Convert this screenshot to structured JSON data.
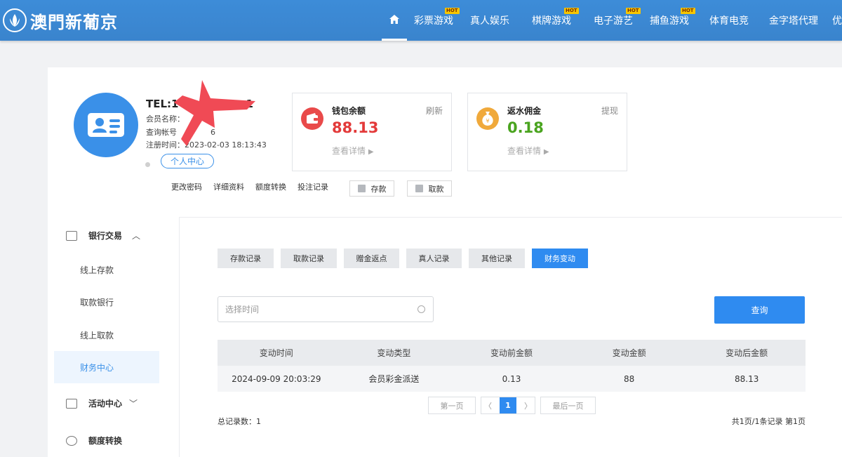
{
  "header": {
    "logo_text": "澳門新葡京",
    "hot_badge": "HOT",
    "nav": [
      {
        "label": "彩票游戏",
        "hot": true
      },
      {
        "label": "真人娱乐",
        "hot": false
      },
      {
        "label": "棋牌游戏",
        "hot": true
      },
      {
        "label": "电子游艺",
        "hot": true
      },
      {
        "label": "捕鱼游戏",
        "hot": true
      },
      {
        "label": "体育电竞",
        "hot": false
      },
      {
        "label": "金字塔代理",
        "hot": false
      },
      {
        "label": "优",
        "hot": false
      }
    ]
  },
  "profile": {
    "tel": "TEL:1",
    "tel_tail": "1",
    "member_name_label": "会员名称：",
    "account_label": "查询帐号",
    "account_tail": "6",
    "register_time": "注册时间：2023-02-03 18:13:43",
    "center_btn": "个人中心"
  },
  "wallet": {
    "label": "钱包余额",
    "action": "刷新",
    "amount": "88.13",
    "detail": "查看详情",
    "color": "#e33a3a"
  },
  "rebate": {
    "label": "返水佣金",
    "action": "提现",
    "amount": "0.18",
    "detail": "查看详情",
    "color": "#4aa41f"
  },
  "quick_links": [
    "更改密码",
    "详细资料",
    "额度转换",
    "投注记录"
  ],
  "deposit_btn": "存款",
  "withdraw_btn": "取款",
  "sidebar": {
    "bank_group": "银行交易",
    "items": [
      "线上存款",
      "取款银行",
      "线上取款",
      "财务中心"
    ],
    "active_index": 3,
    "activity": "活动中心",
    "transfer": "额度转换"
  },
  "tabs": [
    "存款记录",
    "取款记录",
    "赠金返点",
    "真人记录",
    "其他记录",
    "财务变动"
  ],
  "active_tab": 5,
  "date_placeholder": "选择时间",
  "query_btn": "查询",
  "table": {
    "headers": [
      "变动时间",
      "变动类型",
      "变动前金额",
      "变动金额",
      "变动后金额"
    ],
    "rows": [
      [
        "2024-09-09 20:03:29",
        "会员彩金派送",
        "0.13",
        "88",
        "88.13"
      ]
    ]
  },
  "pager": {
    "first": "第一页",
    "prev": "〈",
    "current": "1",
    "next": "〉",
    "last": "最后一页"
  },
  "totals": {
    "left": "总记录数：1",
    "right": "共1页/1条记录 第1页"
  },
  "colors": {
    "primary": "#2f8bf0",
    "header": "#3d8cd8"
  }
}
